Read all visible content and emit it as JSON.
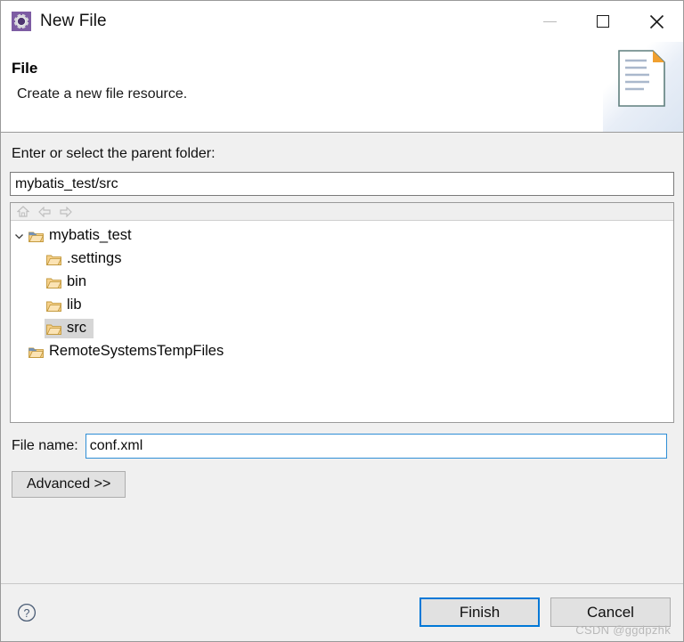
{
  "window": {
    "title": "New File",
    "icon": "eclipse-gear-icon",
    "controls": {
      "minimize": "minimize-icon",
      "maximize": "maximize-icon",
      "close": "close-icon"
    }
  },
  "header": {
    "title": "File",
    "description": "Create a new file resource.",
    "banner_icon": "new-file-document-icon"
  },
  "parent_folder": {
    "label": "Enter or select the parent folder:",
    "value": "mybatis_test/src",
    "placeholder": ""
  },
  "tree": {
    "toolbar": [
      {
        "name": "home-icon",
        "label": "Home"
      },
      {
        "name": "back-arrow-icon",
        "label": "Back"
      },
      {
        "name": "forward-arrow-icon",
        "label": "Forward"
      }
    ],
    "items": [
      {
        "label": "mybatis_test",
        "level": 0,
        "icon": "project-folder-icon",
        "expanded": true,
        "selected": false
      },
      {
        "label": ".settings",
        "level": 1,
        "icon": "folder-icon",
        "expanded": false,
        "selected": false
      },
      {
        "label": "bin",
        "level": 1,
        "icon": "folder-icon",
        "expanded": false,
        "selected": false
      },
      {
        "label": "lib",
        "level": 1,
        "icon": "folder-icon",
        "expanded": false,
        "selected": false
      },
      {
        "label": "src",
        "level": 1,
        "icon": "folder-icon",
        "expanded": false,
        "selected": true
      },
      {
        "label": "RemoteSystemsTempFiles",
        "level": 0,
        "icon": "project-folder-icon",
        "expanded": false,
        "selected": false
      }
    ]
  },
  "file_name": {
    "label": "File name:",
    "value": "conf.xml",
    "placeholder": ""
  },
  "advanced": {
    "label": "Advanced >>"
  },
  "footer": {
    "help_icon": "help-question-icon",
    "finish_label": "Finish",
    "cancel_label": "Cancel",
    "watermark": "CSDN @ggdpzhk"
  },
  "colors": {
    "accent": "#0078d7",
    "dialog_bg": "#f0f0f0",
    "panel_bg": "#ffffff",
    "selection": "#d6d6d6",
    "folder": "#f7c873",
    "eclipse_purple": "#7d5ca3"
  }
}
